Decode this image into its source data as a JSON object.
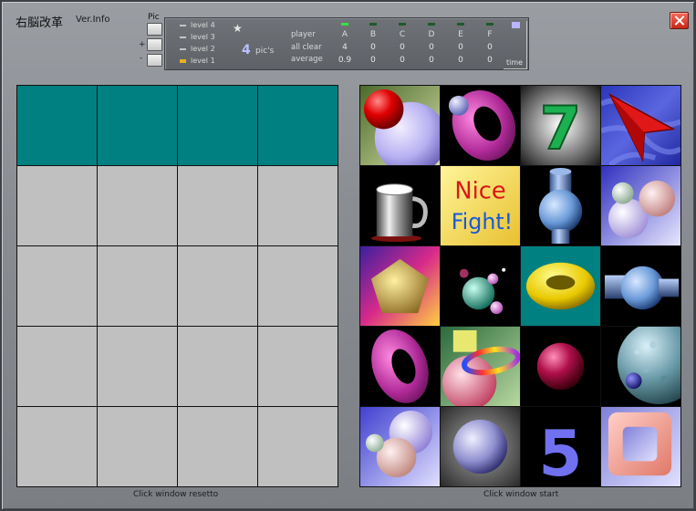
{
  "app": {
    "title": "右脳改革",
    "ver_info": "Ver.Info"
  },
  "pic": {
    "label": "Pic",
    "plus": "+",
    "minus": "-"
  },
  "levels": [
    {
      "label": "level 4",
      "active": false
    },
    {
      "label": "level 3",
      "active": false
    },
    {
      "label": "level 2",
      "active": false
    },
    {
      "label": "level 1",
      "active": true
    }
  ],
  "pics": {
    "count": "4",
    "word": "pic's"
  },
  "stats": {
    "row_labels": [
      "player",
      "all clear",
      "average"
    ],
    "columns": [
      {
        "head": "A",
        "all_clear": "4",
        "average": "0.9",
        "active": true
      },
      {
        "head": "B",
        "all_clear": "0",
        "average": "0",
        "active": false
      },
      {
        "head": "C",
        "all_clear": "0",
        "average": "0",
        "active": false
      },
      {
        "head": "D",
        "all_clear": "0",
        "average": "0",
        "active": false
      },
      {
        "head": "E",
        "all_clear": "0",
        "average": "0",
        "active": false
      },
      {
        "head": "F",
        "all_clear": "0",
        "average": "0",
        "active": false
      }
    ],
    "time_label": "time"
  },
  "left_grid": {
    "teal_cells": 4,
    "total_cells": 20
  },
  "tiles": {
    "nice_line1": "Nice",
    "nice_line2": "Fight!",
    "seven": "7",
    "five": "5"
  },
  "captions": {
    "left": "Click window resetto",
    "right": "Click window start"
  }
}
